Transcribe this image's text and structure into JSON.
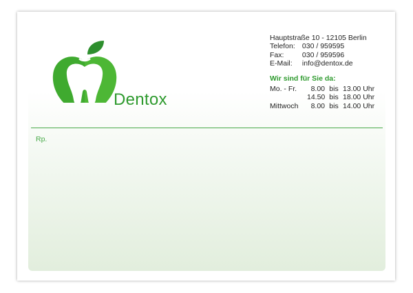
{
  "brand": {
    "name": "Dentox",
    "color": "#2e9a2e"
  },
  "address": {
    "street": "Hauptstraße 10 - 12105 Berlin",
    "phone_label": "Telefon:",
    "phone": "030 / 959595",
    "fax_label": "Fax:",
    "fax": "030 / 959596",
    "email_label": "E-Mail:",
    "email": "info@dentox.de"
  },
  "hours": {
    "title": "Wir sind für Sie da:",
    "rows": [
      {
        "day": "Mo. - Fr.",
        "from": "8.00",
        "sep": "bis",
        "to": "13.00 Uhr"
      },
      {
        "day": "",
        "from": "14.50",
        "sep": "bis",
        "to": "18.00 Uhr"
      },
      {
        "day": "Mittwoch",
        "from": "8.00",
        "sep": "bis",
        "to": "14.00 Uhr"
      }
    ]
  },
  "prescription": {
    "label": "Rp."
  },
  "icons": {
    "logo": "apple-tooth-logo"
  }
}
